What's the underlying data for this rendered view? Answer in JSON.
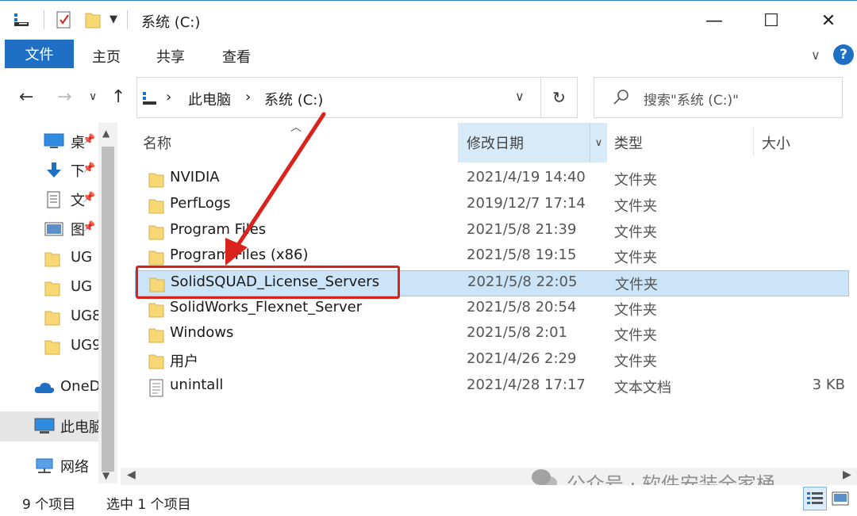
{
  "window": {
    "title": "系统 (C:)",
    "minimize": "—",
    "maximize": "☐",
    "close": "✕"
  },
  "ribbon": {
    "file": "文件",
    "tabs": [
      "主页",
      "共享",
      "查看"
    ],
    "expand_glyph": "∨",
    "help": "?"
  },
  "nav": {
    "back": "←",
    "forward": "→",
    "recent": "∨",
    "up": "↑"
  },
  "address": {
    "sep": "›",
    "crumbs": [
      "此电脑",
      "系统 (C:)"
    ],
    "dropdown": "∨",
    "refresh": "↻"
  },
  "search": {
    "placeholder": "搜索\"系统 (C:)\""
  },
  "sidebar": {
    "items": [
      {
        "label": "桌",
        "icon": "desktop-icon",
        "pinned": true
      },
      {
        "label": "下",
        "icon": "download-icon",
        "pinned": true
      },
      {
        "label": "文",
        "icon": "document-icon",
        "pinned": true
      },
      {
        "label": "图",
        "icon": "picture-icon",
        "pinned": true
      },
      {
        "label": "UG",
        "icon": "folder-icon",
        "pinned": false
      },
      {
        "label": "UG",
        "icon": "folder-icon",
        "pinned": false
      },
      {
        "label": "UG8",
        "icon": "folder-icon",
        "pinned": false
      },
      {
        "label": "UG9",
        "icon": "folder-icon",
        "pinned": false
      },
      {
        "label": "OneD",
        "icon": "cloud-icon",
        "pinned": false
      },
      {
        "label": "此电脑",
        "icon": "computer-icon",
        "pinned": false,
        "selected": true
      },
      {
        "label": "网络",
        "icon": "network-icon",
        "pinned": false
      }
    ],
    "pin_glyph": "📌"
  },
  "columns": {
    "name": "名称",
    "date": "修改日期",
    "type": "类型",
    "size": "大小"
  },
  "files": [
    {
      "name": "NVIDIA",
      "date": "2021/4/19 14:40",
      "type": "文件夹",
      "size": "",
      "kind": "folder"
    },
    {
      "name": "PerfLogs",
      "date": "2019/12/7 17:14",
      "type": "文件夹",
      "size": "",
      "kind": "folder"
    },
    {
      "name": "Program Files",
      "date": "2021/5/8 21:39",
      "type": "文件夹",
      "size": "",
      "kind": "folder"
    },
    {
      "name": "Program Files (x86)",
      "date": "2021/5/8 19:15",
      "type": "文件夹",
      "size": "",
      "kind": "folder"
    },
    {
      "name": "SolidSQUAD_License_Servers",
      "date": "2021/5/8 22:05",
      "type": "文件夹",
      "size": "",
      "kind": "folder",
      "selected": true
    },
    {
      "name": "SolidWorks_Flexnet_Server",
      "date": "2021/5/8 20:54",
      "type": "文件夹",
      "size": "",
      "kind": "folder"
    },
    {
      "name": "Windows",
      "date": "2021/5/8 2:01",
      "type": "文件夹",
      "size": "",
      "kind": "folder"
    },
    {
      "name": "用户",
      "date": "2021/4/26 2:29",
      "type": "文件夹",
      "size": "",
      "kind": "folder"
    },
    {
      "name": "unintall",
      "date": "2021/4/28 17:17",
      "type": "文本文档",
      "size": "3 KB",
      "kind": "text"
    }
  ],
  "status": {
    "count": "9 个项目",
    "selected": "选中 1 个项目"
  },
  "watermark": "公众号 · 软件安装全家桶",
  "colors": {
    "accent": "#1f6fc5",
    "selection": "#cce4f7",
    "annotation": "#d9231c",
    "folder": "#f8d775"
  }
}
